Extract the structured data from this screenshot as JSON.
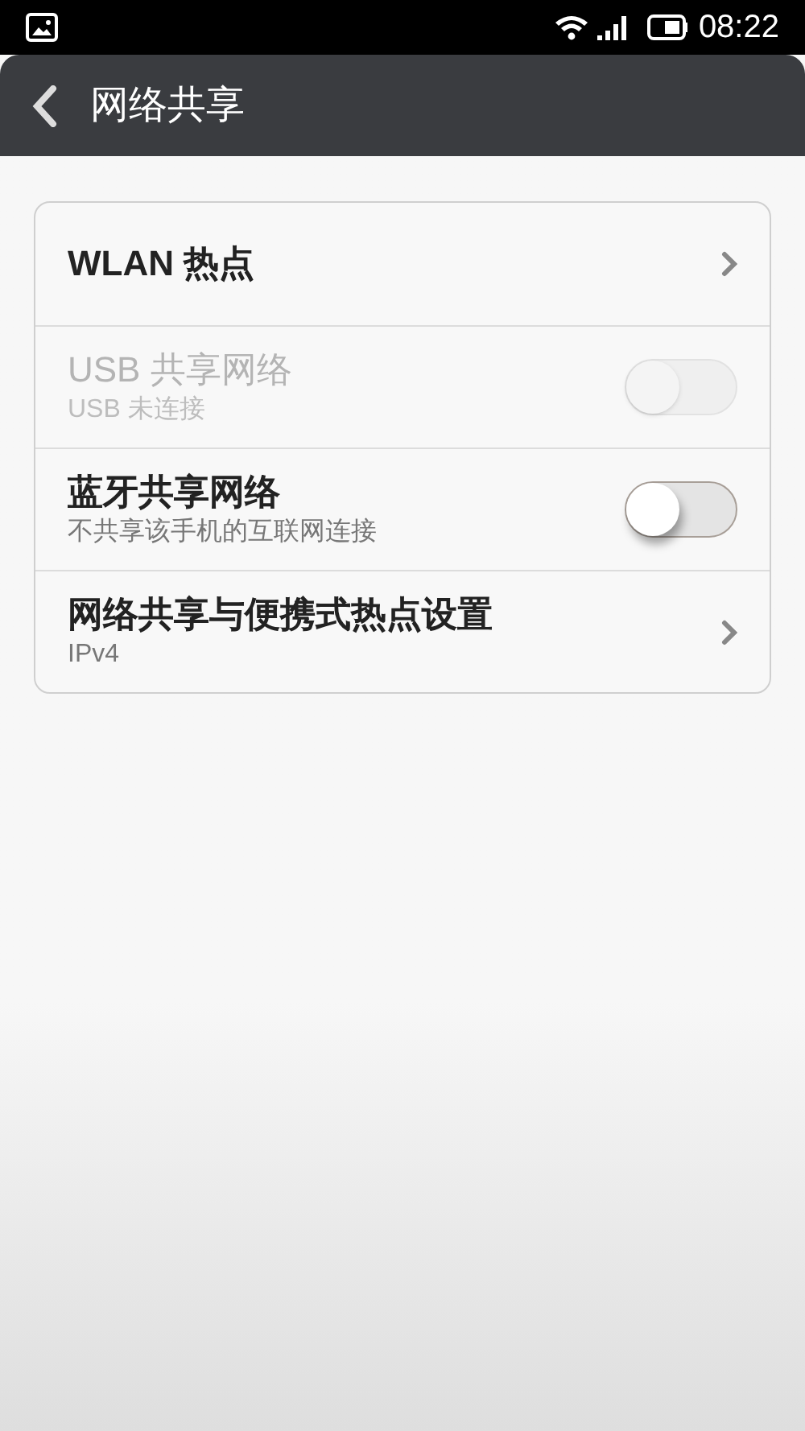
{
  "status_bar": {
    "time": "08:22"
  },
  "header": {
    "title": "网络共享"
  },
  "items": [
    {
      "kind": "link",
      "title": "WLAN 热点",
      "disabled": false
    },
    {
      "kind": "switch",
      "title": "USB 共享网络",
      "subtitle": "USB 未连接",
      "disabled": true,
      "on": false
    },
    {
      "kind": "switch",
      "title": "蓝牙共享网络",
      "subtitle": "不共享该手机的互联网连接",
      "disabled": false,
      "on": false
    },
    {
      "kind": "link",
      "title": "网络共享与便携式热点设置",
      "subtitle": "IPv4",
      "disabled": false
    }
  ]
}
